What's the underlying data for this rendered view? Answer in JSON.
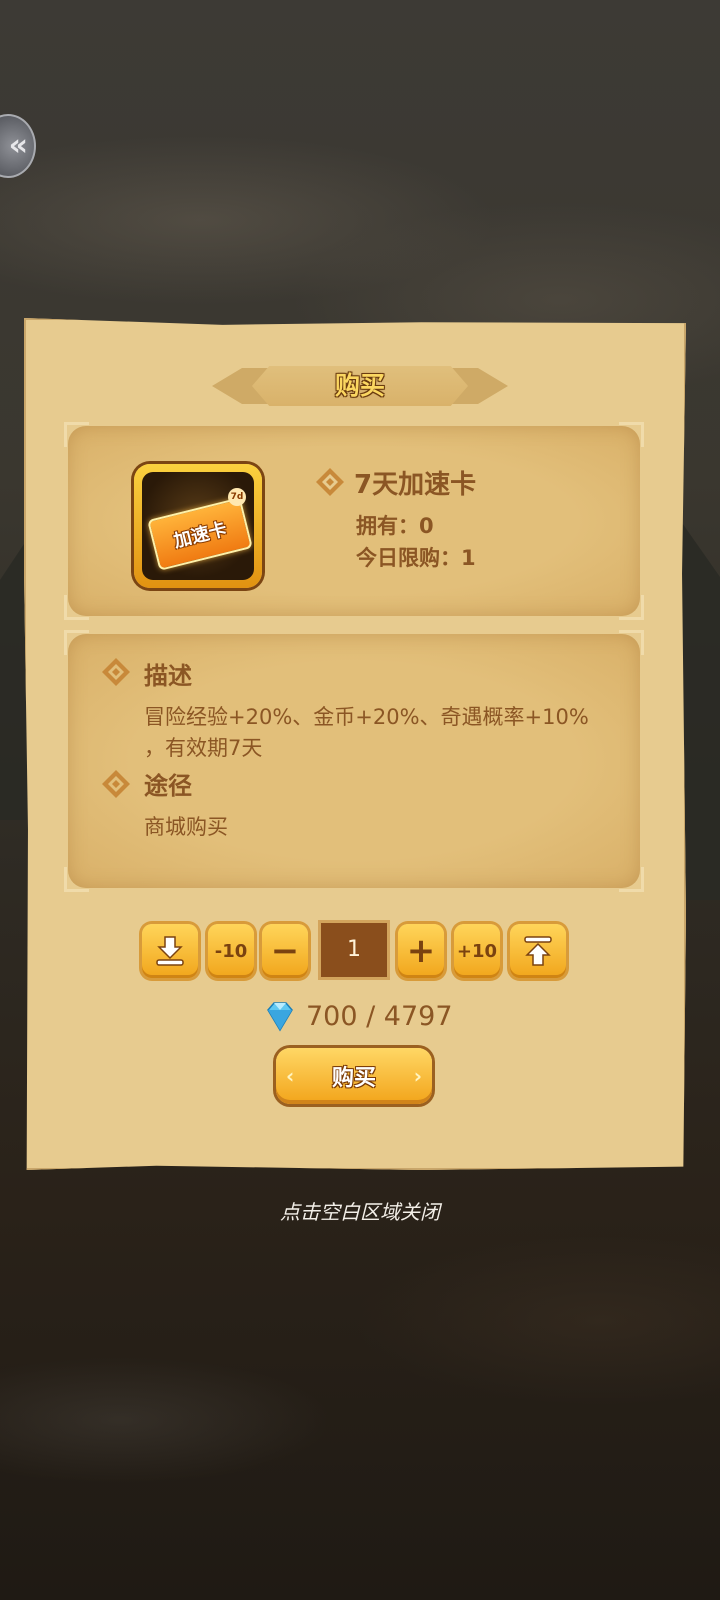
{
  "dialog": {
    "title": "购买",
    "item": {
      "name": "7天加速卡",
      "icon_text": "加速卡",
      "icon_tag": "7d",
      "owned": "拥有：0",
      "daily_limit": "今日限购：1"
    },
    "description": {
      "heading": "描述",
      "text_line1": "冒险经验+20%、金币+20%、奇遇概率+10%",
      "text_line2": "，有效期7天"
    },
    "source": {
      "heading": "途径",
      "text": "商城购买"
    },
    "quantity": {
      "value": "1",
      "minus10_label": "-10",
      "minus_label": "−",
      "plus_label": "+",
      "plus10_label": "+10"
    },
    "price": {
      "text": "700 / 4797",
      "icon": "diamond-gem-icon"
    },
    "buy_button_label": "购买"
  },
  "close_hint": "点击空白区域关闭",
  "colors": {
    "panel": "#e7cb8f",
    "text_brown": "#8b5624",
    "button_gold": "#f1a51b"
  }
}
